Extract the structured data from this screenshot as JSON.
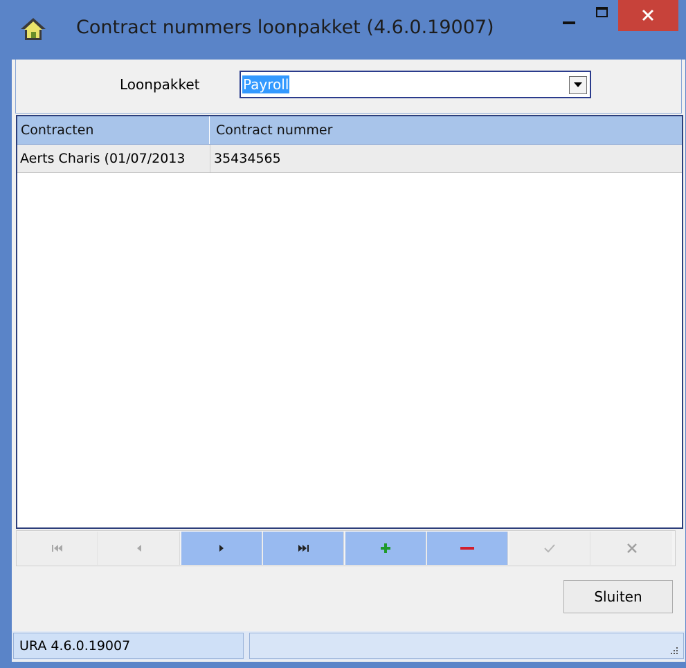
{
  "window": {
    "title": "Contract nummers loonpakket (4.6.0.19007)",
    "icons": [
      "app-house-icon",
      "minimize-icon",
      "maximize-icon",
      "close-icon"
    ],
    "close_color": "#c7423a",
    "title_bar_color": "#5a84c8"
  },
  "filter": {
    "label": "Loonpakket",
    "selected_value": "Payroll"
  },
  "grid": {
    "columns": [
      "Contracten",
      "Contract nummer"
    ],
    "rows": [
      [
        "Aerts Charis (01/07/2013",
        "35434565"
      ]
    ],
    "header_color": "#a8c4ea"
  },
  "navigator": {
    "buttons": [
      {
        "name": "first-record",
        "icon": "first-icon",
        "enabled": false
      },
      {
        "name": "prior-record",
        "icon": "prior-icon",
        "enabled": false
      },
      {
        "name": "next-record",
        "icon": "next-icon",
        "enabled": true
      },
      {
        "name": "last-record",
        "icon": "last-icon",
        "enabled": true
      },
      {
        "name": "insert-record",
        "icon": "plus-icon",
        "enabled": true
      },
      {
        "name": "delete-record",
        "icon": "minus-icon",
        "enabled": true
      },
      {
        "name": "post-record",
        "icon": "check-icon",
        "enabled": false
      },
      {
        "name": "cancel-record",
        "icon": "cancel-icon",
        "enabled": false
      }
    ],
    "active_color": "#98baf0"
  },
  "actions": {
    "close_label": "Sluiten"
  },
  "statusbar": {
    "version": "URA 4.6.0.19007"
  }
}
